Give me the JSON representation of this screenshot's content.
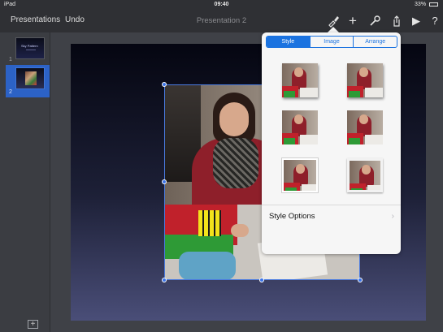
{
  "status_bar": {
    "device": "iPad",
    "time": "09:40",
    "battery": "33%"
  },
  "toolbar": {
    "presentations_label": "Presentations",
    "undo_label": "Undo",
    "document_title": "Presentation 2",
    "icons": [
      "format-brush-icon",
      "add-icon",
      "wrench-icon",
      "share-icon",
      "play-icon",
      "help-icon"
    ],
    "add_glyph": "+",
    "play_glyph": "▶",
    "help_glyph": "?"
  },
  "sidebar": {
    "slides": [
      {
        "number": "1",
        "title": "Sky Pattern"
      },
      {
        "number": "2"
      }
    ],
    "add_slide_glyph": "+"
  },
  "popover": {
    "tabs": [
      "Style",
      "Image",
      "Arrange"
    ],
    "active_tab": "Style",
    "style_count": 6,
    "style_options_label": "Style Options",
    "chevron_glyph": "›"
  },
  "colors": {
    "accent": "#1b73e0",
    "selection": "#3c74e8",
    "toolbar_bg": "#2f3034"
  }
}
